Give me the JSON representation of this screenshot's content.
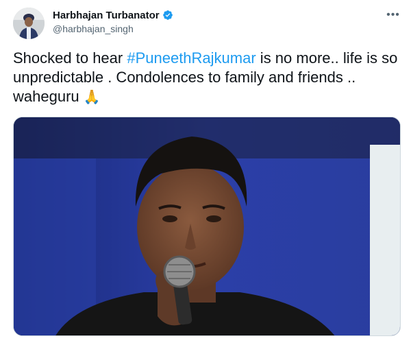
{
  "author": {
    "display_name": "Harbhajan Turbanator",
    "handle": "@harbhajan_singh",
    "verified": true
  },
  "tweet": {
    "text_before": "Shocked to hear ",
    "hashtag": "#PuneethRajkumar",
    "text_after": " is no more.. life is so unpredictable . Condolences to family and friends .. waheguru ",
    "emoji": "🙏"
  },
  "colors": {
    "accent": "#1d9bf0",
    "text": "#0f1419",
    "secondary": "#536471"
  },
  "icons": {
    "more": "more-horizontal-icon",
    "verified": "verified-badge-icon"
  }
}
